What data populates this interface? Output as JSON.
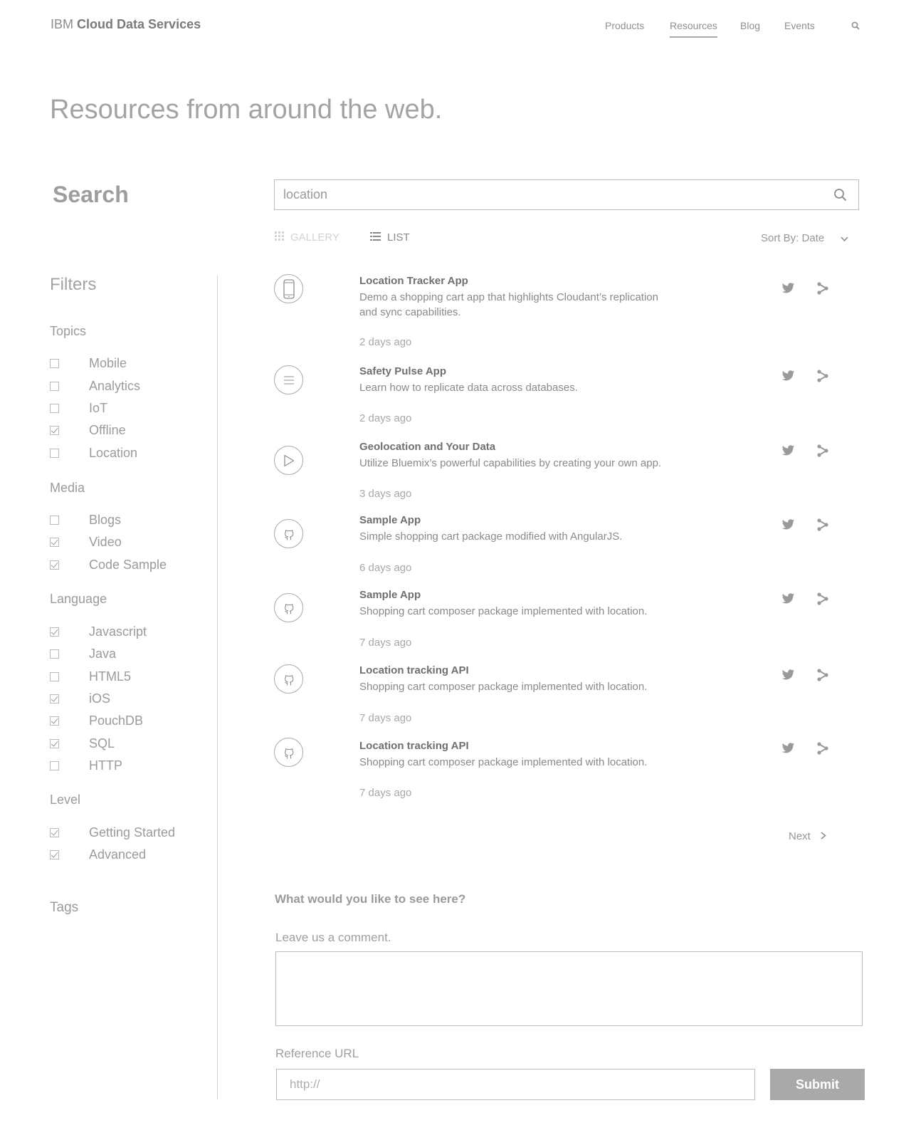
{
  "header": {
    "brand_prefix": "IBM",
    "brand_name": "Cloud Data Services",
    "nav": [
      {
        "label": "Products",
        "active": false
      },
      {
        "label": "Resources",
        "active": true
      },
      {
        "label": "Blog",
        "active": false
      },
      {
        "label": "Events",
        "active": false
      }
    ],
    "search_icon": "search-icon"
  },
  "page": {
    "title": "Resources from around the web.",
    "search_heading": "Search"
  },
  "search": {
    "value": "location",
    "icon": "search-icon"
  },
  "view": {
    "gallery_label": "GALLERY",
    "list_label": "LIST",
    "active": "list",
    "sort_label": "Sort By: Date"
  },
  "filters": {
    "heading": "Filters",
    "groups": [
      {
        "title": "Topics",
        "items": [
          {
            "label": "Mobile",
            "checked": false
          },
          {
            "label": "Analytics",
            "checked": false
          },
          {
            "label": "IoT",
            "checked": false
          },
          {
            "label": "Offline",
            "checked": true
          },
          {
            "label": "Location",
            "checked": false
          }
        ]
      },
      {
        "title": "Media",
        "items": [
          {
            "label": "Blogs",
            "checked": false
          },
          {
            "label": "Video",
            "checked": true
          },
          {
            "label": "Code Sample",
            "checked": true
          }
        ]
      },
      {
        "title": "Language",
        "items": [
          {
            "label": "Javascript",
            "checked": true
          },
          {
            "label": "Java",
            "checked": false
          },
          {
            "label": "HTML5",
            "checked": false
          },
          {
            "label": "iOS",
            "checked": true
          },
          {
            "label": "PouchDB",
            "checked": true
          },
          {
            "label": "SQL",
            "checked": true
          },
          {
            "label": "HTTP",
            "checked": false
          }
        ]
      },
      {
        "title": "Level",
        "items": [
          {
            "label": "Getting Started",
            "checked": true
          },
          {
            "label": "Advanced",
            "checked": true
          }
        ]
      }
    ],
    "tags_heading": "Tags"
  },
  "results": [
    {
      "icon": "mobile-phone-icon",
      "title": "Location Tracker App",
      "description": "Demo a shopping cart app that highlights Cloudant’s replication and sync capabilities.",
      "date": "2 days ago"
    },
    {
      "icon": "document-lines-icon",
      "title": "Safety Pulse App",
      "description": "Learn how to replicate data across databases.",
      "date": "2 days ago"
    },
    {
      "icon": "play-icon",
      "title": "Geolocation and Your Data",
      "description": "Utilize Bluemix’s powerful capabilities by creating your own app.",
      "date": "3 days ago"
    },
    {
      "icon": "github-icon",
      "title": "Sample App",
      "description": "Simple shopping cart package modified with AngularJS.",
      "date": "6 days ago"
    },
    {
      "icon": "github-icon",
      "title": "Sample App",
      "description": "Shopping cart composer package implemented with location.",
      "date": "7 days ago"
    },
    {
      "icon": "github-icon",
      "title": "Location tracking API",
      "description": "Shopping cart composer package implemented with location.",
      "date": "7 days ago"
    },
    {
      "icon": "github-icon",
      "title": "Location tracking API",
      "description": "Shopping cart composer package implemented with location.",
      "date": "7 days ago"
    }
  ],
  "pagination": {
    "next_label": "Next"
  },
  "feedback": {
    "question": "What would you like to see here?",
    "comment_label": "Leave us a comment.",
    "comment_value": "",
    "url_label": "Reference URL",
    "url_placeholder": "http://",
    "submit_label": "Submit"
  },
  "colors": {
    "text": "#8a8a8a",
    "title_text": "#6f6f6f",
    "border": "#bdbdbd",
    "submit_bg": "#a9a9a9"
  }
}
